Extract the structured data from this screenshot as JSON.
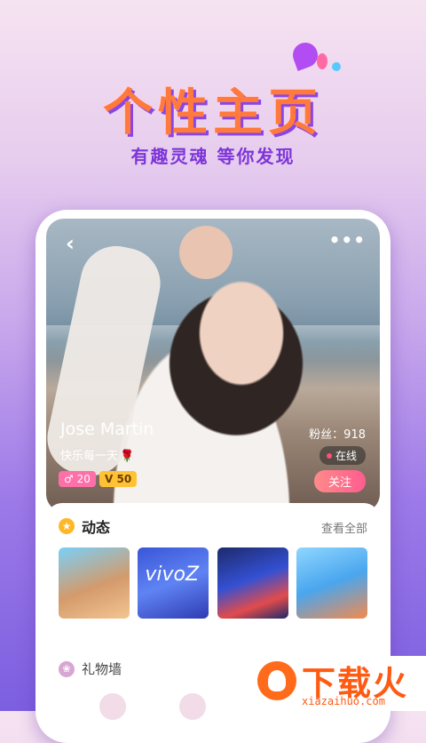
{
  "hero": {
    "title": "个性主页",
    "subtitle": "有趣灵魂 等你发现"
  },
  "profile": {
    "name": "Jose Martin",
    "signature": "快乐每一天",
    "signature_emoji": "🌹",
    "gender_badge": "♂ 20",
    "vip_badge": "V 50",
    "fans": "粉丝：918",
    "online_status": "在线",
    "follow_label": "关注",
    "carousel_pages": 4,
    "carousel_active": 1
  },
  "feed": {
    "section_title": "动态",
    "view_all": "查看全部",
    "thumb2_text": "vivoZ"
  },
  "gifts": {
    "section_title": "礼物墙"
  },
  "watermark": {
    "text": "下载火",
    "url": "xiazaihuo.com"
  },
  "colors": {
    "accent_orange": "#ff7a3c",
    "accent_purple": "#7d35d9",
    "follow_pink": "#ff5d8f",
    "vip_yellow": "#ffc234"
  }
}
